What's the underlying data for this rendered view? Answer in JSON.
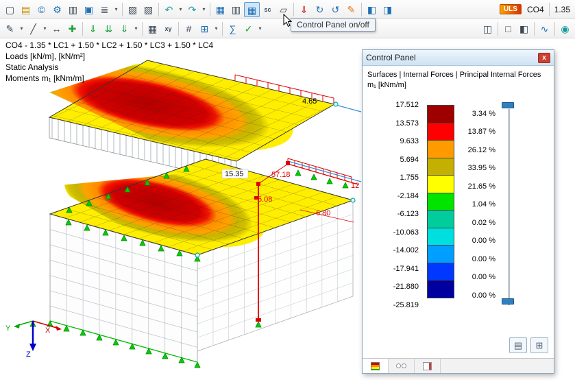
{
  "toolbar": {
    "row1": [
      "▢",
      "▤",
      "©",
      "⚙",
      "▥",
      "▣",
      "≣",
      "▾",
      "▨",
      "▧",
      "↶",
      "▾",
      "↷",
      "▾",
      "▦",
      "▥",
      "▦",
      "sc",
      "▱",
      "⇓",
      "↻",
      "↺",
      "✎",
      "◧",
      "◨"
    ],
    "row2": [
      "✎",
      "▾",
      "╱",
      "▾",
      "↔",
      "✚",
      "⇓",
      "⇊",
      "⇓",
      "▾",
      "▦",
      "xy",
      "#",
      "⊞",
      "▾",
      "∑",
      "✓",
      "▾",
      "◫",
      "□",
      "◧",
      "∿",
      "◉"
    ],
    "uls_badge": "ULS",
    "combo": "CO4",
    "factor": "1.35",
    "tooltip": "Control Panel on/off"
  },
  "info": {
    "lines": [
      "CO4 - 1.35 * LC1 + 1.50 * LC2 + 1.50 * LC3 + 1.50 * LC4",
      "Loads [kN/m], [kN/m²]",
      "Static Analysis",
      "Moments m₁ [kNm/m]"
    ]
  },
  "model": {
    "dims": [
      "4.65",
      "15.35",
      "57.18",
      "5.08",
      "6.80",
      "12"
    ],
    "axes": {
      "x": "X",
      "y": "Y",
      "z": "Z"
    }
  },
  "control_panel": {
    "title": "Control Panel",
    "close_label": "x",
    "subtitle": "Surfaces | Internal Forces | Principal Internal Forces",
    "quantity": "m₁ [kNm/m]",
    "scale": {
      "values": [
        "17.512",
        "13.573",
        "9.633",
        "5.694",
        "1.755",
        "-2.184",
        "-6.123",
        "-10.063",
        "-14.002",
        "-17.941",
        "-21.880",
        "-25.819"
      ],
      "percents": [
        "3.34 %",
        "13.87 %",
        "26.12 %",
        "33.95 %",
        "21.65 %",
        "1.04 %",
        "0.02 %",
        "0.00 %",
        "0.00 %",
        "0.00 %",
        "0.00 %"
      ],
      "colors": [
        "#9e0000",
        "#fe0000",
        "#ff9b00",
        "#c4b000",
        "#ffff00",
        "#00e400",
        "#00cd9b",
        "#00dfdf",
        "#009fff",
        "#0038ff",
        "#0000a0"
      ]
    },
    "buttons": [
      "▤",
      "⊞"
    ]
  }
}
